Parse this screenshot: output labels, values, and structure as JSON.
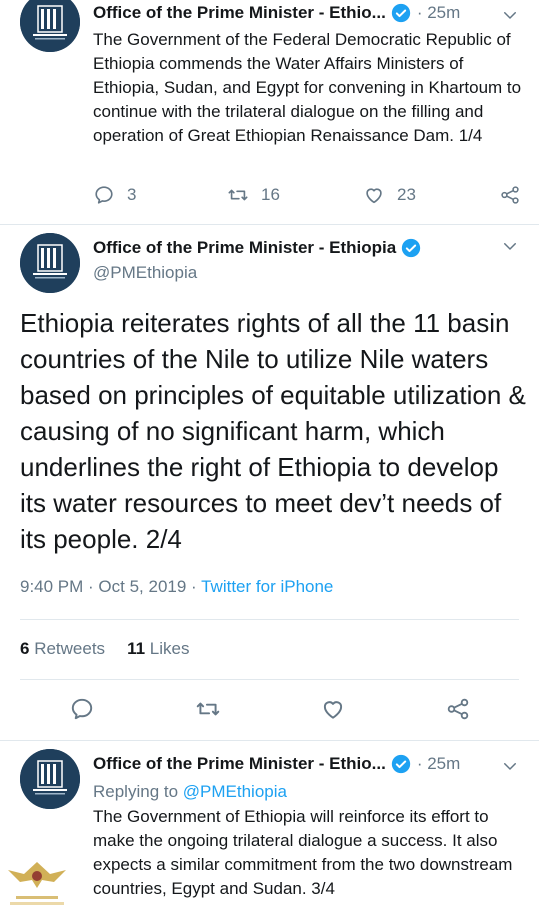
{
  "tweets": [
    {
      "name": "Office of the Prime Minister - Ethio...",
      "time": "· 25m",
      "text": "The Government of the Federal Democratic Republic of Ethiopia commends the Water Affairs Ministers of Ethiopia, Sudan, and Egypt for convening in Khartoum to continue with the trilateral dialogue on the filling and operation of Great Ethiopian Renaissance Dam. 1/4",
      "replies": "3",
      "retweets": "16",
      "likes": "23"
    },
    {
      "name": "Office of the Prime Minister - Ethiopia",
      "handle": "@PMEthiopia",
      "text": "Ethiopia reiterates rights of all the 11 basin countries of the Nile to utilize Nile waters based on principles of equitable utilization & causing of no significant harm, which underlines the right of Ethiopia to develop its water resources to meet dev’t needs of its people. 2/4",
      "timestamp": "9:40 PM · Oct 5, 2019 · ",
      "source": "Twitter for iPhone",
      "retweet_count": "6",
      "retweet_label": " Retweets",
      "like_count": "11",
      "like_label": " Likes"
    },
    {
      "name": "Office of the Prime Minister - Ethio...",
      "time": "· 25m",
      "replying_label": "Replying to ",
      "replying_mention": "@PMEthiopia",
      "text": "The Government of Ethiopia will reinforce its effort to make the ongoing trilateral dialogue a success. It also expects a similar commitment from the two downstream countries, Egypt and Sudan. 3/4"
    }
  ],
  "colors": {
    "link": "#1da1f2",
    "secondary": "#657786",
    "divider": "#e1e8ed",
    "avatar_bg": "#1f3f5c"
  },
  "icons": [
    "reply-icon",
    "retweet-icon",
    "like-icon",
    "share-icon",
    "verified-icon",
    "caret-down-icon"
  ]
}
